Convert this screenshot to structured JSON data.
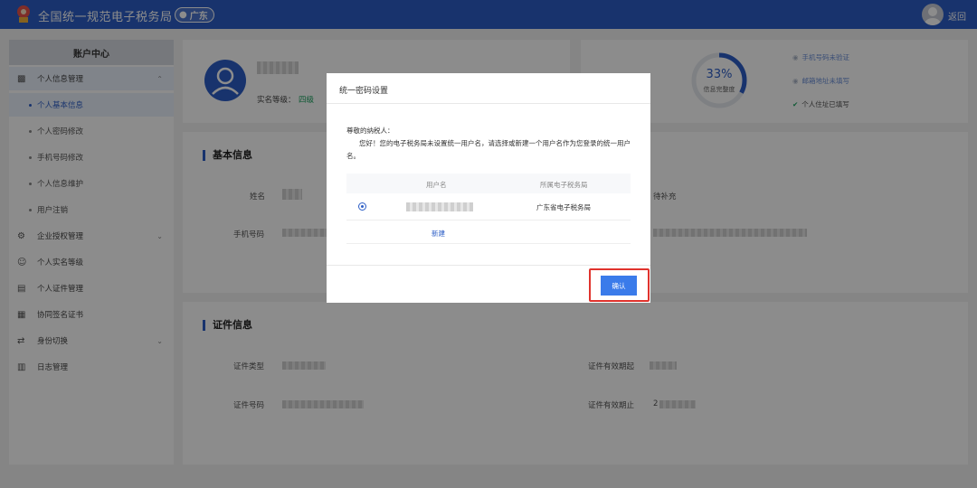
{
  "header": {
    "app_title": "全国统一规范电子税务局",
    "region": "广东",
    "back_label": "返回"
  },
  "sidebar": {
    "title": "账户中心",
    "groups": [
      {
        "label": "个人信息管理",
        "icon": "id-card-icon",
        "expanded": true
      },
      {
        "label": "企业授权管理",
        "icon": "gear-icon",
        "expanded": false
      },
      {
        "label": "个人实名等级",
        "icon": "person-icon",
        "expanded": false
      },
      {
        "label": "个人证件管理",
        "icon": "document-icon",
        "expanded": false
      },
      {
        "label": "协同签名证书",
        "icon": "certificate-icon",
        "expanded": false
      },
      {
        "label": "身份切换",
        "icon": "switch-icon",
        "expanded": false
      },
      {
        "label": "日志管理",
        "icon": "log-icon",
        "expanded": false
      }
    ],
    "sub_items": [
      {
        "label": "个人基本信息",
        "active": true
      },
      {
        "label": "个人密码修改",
        "active": false
      },
      {
        "label": "手机号码修改",
        "active": false
      },
      {
        "label": "个人信息维护",
        "active": false
      },
      {
        "label": "用户注销",
        "active": false
      }
    ]
  },
  "profile": {
    "realname_level_label": "实名等级：",
    "realname_level_value": "四级",
    "completion_percent": 33,
    "completion_label": "信息完整度",
    "checks": [
      {
        "label": "手机号码未验证",
        "status": "pending"
      },
      {
        "label": "邮箱地址未填写",
        "status": "pending"
      },
      {
        "label": "个人住址已填写",
        "status": "done"
      }
    ]
  },
  "basic_info": {
    "title": "基本信息",
    "name_label": "姓名",
    "phone_label": "手机号码",
    "pending_value": "待补充"
  },
  "cert_info": {
    "title": "证件信息",
    "type_label": "证件类型",
    "number_label": "证件号码",
    "valid_from_label": "证件有效期起",
    "valid_to_label": "证件有效期止",
    "valid_to_value_prefix": "2"
  },
  "modal": {
    "title": "统一密码设置",
    "greeting": "尊敬的纳税人：",
    "message": "您好！您的电子税务局未设置统一用户名，请选择或新建一个用户名作为您登录的统一用户名。",
    "col_username": "用户名",
    "col_bureau": "所属电子税务局",
    "rows": [
      {
        "bureau": "广东省电子税务局",
        "selected": true
      }
    ],
    "new_label": "新建",
    "confirm_label": "确认"
  },
  "colors": {
    "primary": "#2d5ec6",
    "button": "#3a7bea",
    "highlight": "#e0332d",
    "success": "#1aa260"
  }
}
